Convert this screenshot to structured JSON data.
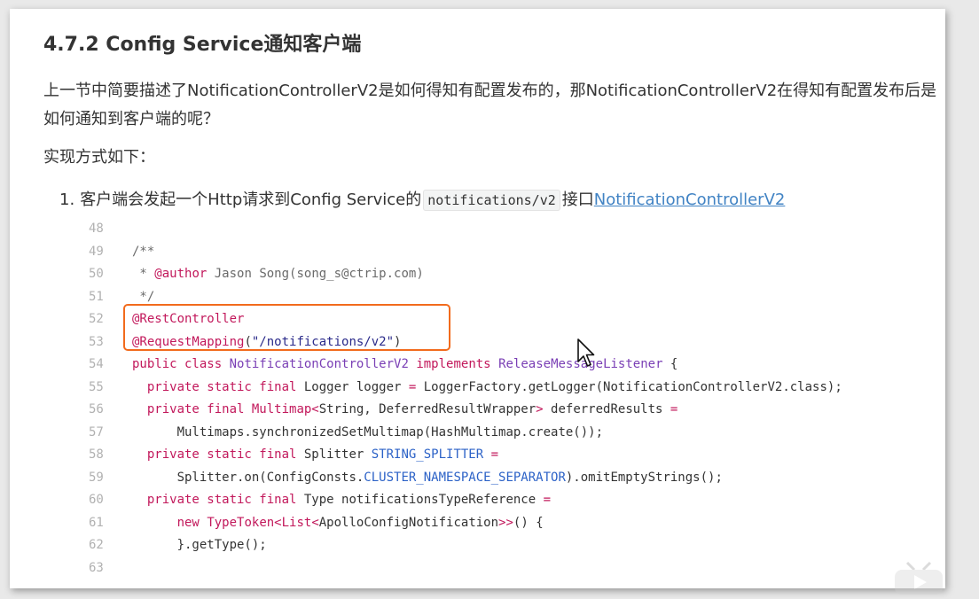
{
  "heading": "4.7.2  Config Service通知客户端",
  "intro": "上一节中简要描述了NotificationControllerV2是如何得知有配置发布的，那NotificationControllerV2在得知有配置发布后是如何通知到客户端的呢？",
  "method_label": "实现方式如下：",
  "step1": {
    "number": "1.",
    "text_before": "客户端会发起一个Http请求到Config Service的",
    "code": "notifications/v2",
    "text_after": "接口",
    "link": "NotificationControllerV2"
  },
  "code_block": {
    "line_numbers": [
      "48",
      "49",
      "50",
      "51",
      "52",
      "53",
      "54",
      "55",
      "56",
      "57",
      "58",
      "59",
      "60",
      "61",
      "62",
      "63"
    ],
    "line49": "/**",
    "line50_prefix": " * ",
    "line50_tag": "@author",
    "line50_rest": " Jason Song(song_s@ctrip.com)",
    "line51": " */",
    "line52": "@RestController",
    "line53_ann": "@RequestMapping",
    "line53_p1": "(",
    "line53_str": "\"/notifications/v2\"",
    "line53_p2": ")",
    "line54_kw": "public class",
    "line54_name": "NotificationControllerV2",
    "line54_impl": "implements",
    "line54_iface": "ReleaseMessageListener",
    "line54_brace": " {",
    "line55_kw": "private static final",
    "line55_rest1": " Logger logger ",
    "line55_eq": "=",
    "line55_rest2": " LoggerFactory.getLogger(NotificationControllerV2.class);",
    "line56_kw": "private final",
    "line56_type": "Multimap<",
    "line56_rest1": "String, DeferredResultWrapper",
    "line56_gt": ">",
    "line56_rest2": " deferredResults ",
    "line56_eq": "=",
    "line57": "Multimaps.synchronizedSetMultimap(HashMultimap.create());",
    "line58_kw": "private static final",
    "line58_rest": " Splitter ",
    "line58_const": "STRING_SPLITTER",
    "line58_eq": " =",
    "line59_pre": "Splitter.on(ConfigConsts.",
    "line59_const": "CLUSTER_NAMESPACE_SEPARATOR",
    "line59_post": ").omitEmptyStrings();",
    "line60_kw": "private static final",
    "line60_rest": " Type notificationsTypeReference ",
    "line60_eq": "=",
    "line61_kw": "new",
    "line61_type": "TypeToken<List<",
    "line61_rest": "ApolloConfigNotification",
    "line61_gt": ">>",
    "line61_post": "() {",
    "line62": "}.getType();"
  },
  "colors": {
    "highlight_border": "#f26b1d",
    "link": "#4183c4",
    "keyword": "#c2185b",
    "constant": "#2c62c7"
  },
  "icons": [
    "mouse-cursor-icon",
    "play-icon"
  ]
}
